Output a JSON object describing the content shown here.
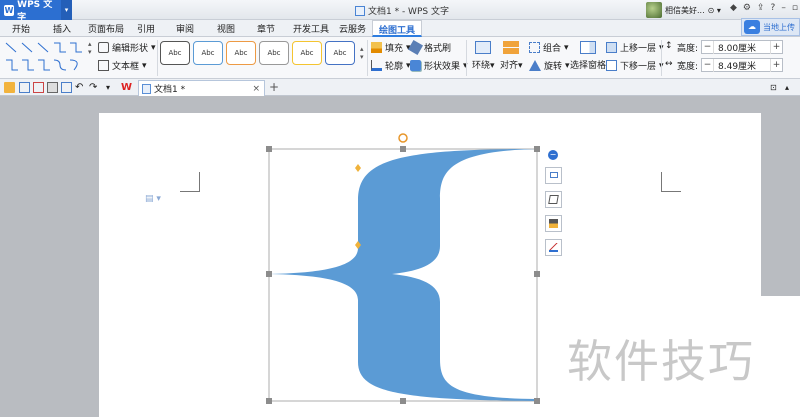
{
  "app": {
    "name": "WPS 文字",
    "window_title": "文档1 * - WPS 文字",
    "user": "相信美好..."
  },
  "menu_tabs": [
    "开始",
    "插入",
    "页面布局",
    "引用",
    "审阅",
    "视图",
    "章节",
    "开发工具",
    "云服务",
    "绘图工具"
  ],
  "active_tab": "绘图工具",
  "login_button": "当地上传",
  "ribbon": {
    "edit_shape": "编辑形状",
    "text_box": "文本框",
    "style_samples": [
      "Abc",
      "Abc",
      "Abc",
      "Abc",
      "Abc",
      "Abc"
    ],
    "style_colors": [
      "#555555",
      "#5b9bd5",
      "#ed9a44",
      "#999999",
      "#f4c430",
      "#4472c4"
    ],
    "fill": "填充",
    "format_painter": "格式刷",
    "outline": "轮廓",
    "shape_effects": "形状效果",
    "wrap": "环绕",
    "align": "对齐",
    "group": "组合",
    "rotate": "旋转",
    "selection_pane": "选择窗格",
    "bring_forward": "上移一层",
    "send_backward": "下移一层",
    "height_label": "高度:",
    "height_value": "8.00厘米",
    "width_label": "宽度:",
    "width_value": "8.49厘米"
  },
  "document_tab": {
    "title": "文档1 *",
    "close": "×",
    "add": "+"
  },
  "shape": {
    "kind": "left-brace",
    "fill_color": "#5b9bd5"
  },
  "watermark": "软件技巧",
  "colors": {
    "accent": "#2c6fd1",
    "shape_fill": "#5b9bd5"
  }
}
